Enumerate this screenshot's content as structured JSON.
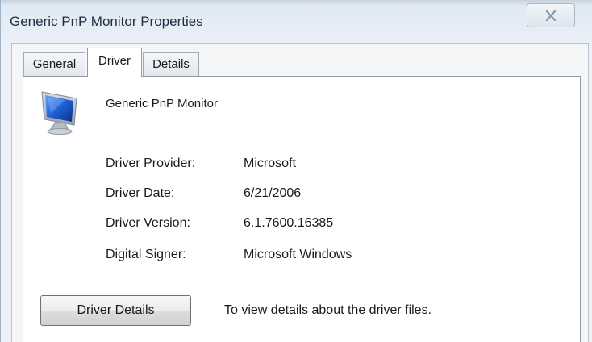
{
  "window": {
    "title": "Generic PnP Monitor Properties",
    "close_icon": "close-icon"
  },
  "tabs": [
    {
      "label": "General",
      "selected": false
    },
    {
      "label": "Driver",
      "selected": true
    },
    {
      "label": "Details",
      "selected": false
    }
  ],
  "device": {
    "name": "Generic PnP Monitor",
    "icon": "monitor-icon"
  },
  "properties": [
    {
      "label": "Driver Provider:",
      "value": "Microsoft"
    },
    {
      "label": "Driver Date:",
      "value": "6/21/2006"
    },
    {
      "label": "Driver Version:",
      "value": "6.1.7600.16385"
    },
    {
      "label": "Digital Signer:",
      "value": "Microsoft Windows"
    }
  ],
  "driver_details": {
    "button_label": "Driver Details",
    "description": "To view details about the driver files."
  },
  "colors": {
    "accent": "#1f5fd6",
    "title_text": "#1e2f44"
  }
}
